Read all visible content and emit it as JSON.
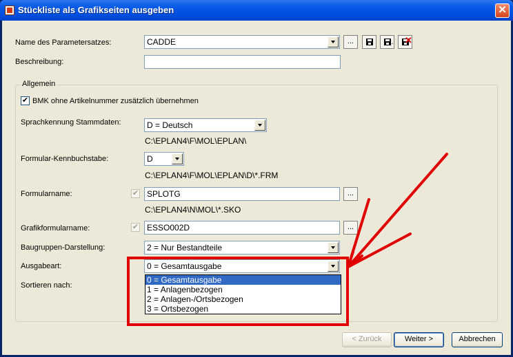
{
  "window": {
    "title": "Stückliste als Grafikseiten ausgeben",
    "close_glyph": "✕"
  },
  "form": {
    "param_set_label": "Name des Parametersatzes:",
    "param_set_value": "CADDE",
    "dots": "...",
    "description_label": "Beschreibung:",
    "description_value": "",
    "group_title": "Allgemein",
    "bmk_label": "BMK ohne Artikelnummer zusätzlich übernehmen",
    "bmk_checked": true,
    "lang_label": "Sprachkennung Stammdaten:",
    "lang_value": "D = Deutsch",
    "lang_path": "C:\\EPLAN4\\F\\MOL\\EPLAN\\",
    "form_letter_label": "Formular-Kennbuchstabe:",
    "form_letter_value": "D",
    "form_letter_path": "C:\\EPLAN4\\F\\MOL\\EPLAN\\D\\*.FRM",
    "formname_label": "Formularname:",
    "formname_value": "SPLOTG",
    "formname_path": "C:\\EPLAN4\\N\\MOL\\*.SKO",
    "graphic_label": "Grafikformularname:",
    "graphic_value": "ESSO002D",
    "assembly_label": "Baugruppen-Darstellung:",
    "assembly_value": "2 = Nur Bestandteile",
    "output_label": "Ausgabeart:",
    "output_value": "0 = Gesamtausgabe",
    "output_options": [
      "0 = Gesamtausgabe",
      "1 = Anlagenbezogen",
      "2 = Anlagen-/Ortsbezogen",
      "3 = Ortsbezogen"
    ],
    "sort_label": "Sortieren nach:"
  },
  "buttons": {
    "back": "< Zurück",
    "next": "Weiter >",
    "cancel": "Abbrechen"
  },
  "annotation_color": "#e00000"
}
